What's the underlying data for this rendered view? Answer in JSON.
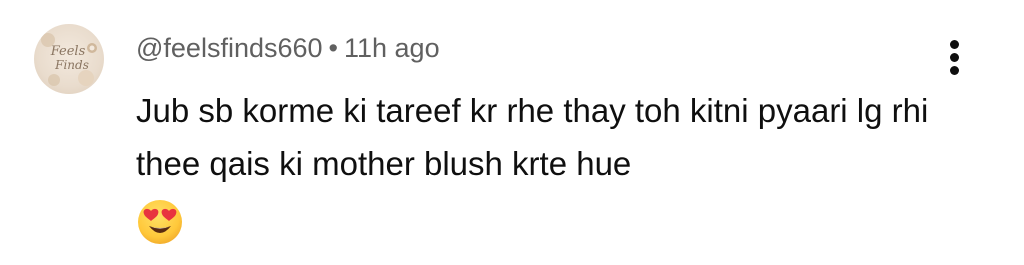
{
  "comment": {
    "author": "@feelsfinds660",
    "separator": "•",
    "timestamp": "11h ago",
    "avatar_text_line1": "Feels",
    "avatar_text_line2": "Finds",
    "text": "Jub sb korme ki tareef kr rhe thay toh kitni pyaari lg rhi thee qais ki mother blush krte hue",
    "emoji": "smiling-face-with-heart-eyes",
    "menu_icon": "more-vertical-icon"
  },
  "colors": {
    "meta_text": "#606060",
    "body_text": "#0f0f0f",
    "background": "#ffffff",
    "emoji_face": "#ffcc33",
    "emoji_hearts": "#e8343f"
  }
}
